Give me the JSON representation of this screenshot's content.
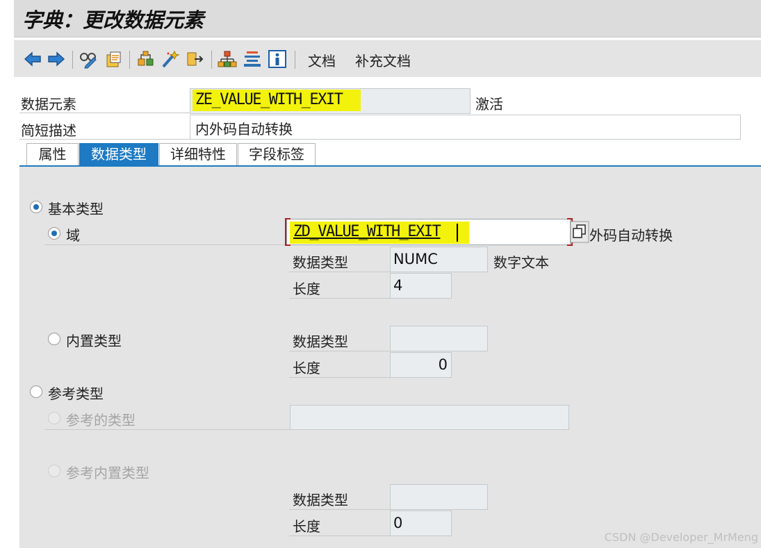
{
  "window": {
    "title": "字典：更改数据元素"
  },
  "toolbar": {
    "icons": [
      "back-icon",
      "forward-icon",
      "display-change-icon",
      "other-object-icon",
      "where-used-icon",
      "activate-icon",
      "check-icon",
      "hierarchy-icon",
      "navigation-stack-icon",
      "info-icon"
    ],
    "documentation": "文档",
    "supplementary_documentation": "补充文档"
  },
  "header": {
    "data_element_label": "数据元素",
    "data_element_value": "ZE_VALUE_WITH_EXIT",
    "status": "激活",
    "short_desc_label": "简短描述",
    "short_desc_value": "内外码自动转换"
  },
  "tabs": [
    {
      "label": "属性",
      "active": false
    },
    {
      "label": "数据类型",
      "active": true
    },
    {
      "label": "详细特性",
      "active": false
    },
    {
      "label": "字段标签",
      "active": false
    }
  ],
  "content": {
    "elementary_type": {
      "label": "基本类型",
      "selected": true
    },
    "domain": {
      "label": "域",
      "selected": true,
      "value": "ZD_VALUE_WITH_EXIT",
      "description": "外码自动转换",
      "data_type_label": "数据类型",
      "data_type_value": "NUMC",
      "data_type_desc": "数字文本",
      "length_label": "长度",
      "length_value": "4"
    },
    "builtin_type": {
      "label": "内置类型",
      "selected": false,
      "data_type_label": "数据类型",
      "data_type_value": "",
      "length_label": "长度",
      "length_value": "0"
    },
    "reference_type": {
      "label": "参考类型",
      "selected": false
    },
    "name_of_ref_type": {
      "label": "参考的类型",
      "value": ""
    },
    "ref_builtin_type": {
      "label": "参考内置类型",
      "data_type_label": "数据类型",
      "data_type_value": "",
      "length_label": "长度",
      "length_value": "0"
    }
  },
  "colors": {
    "accent": "#1d7ac3",
    "highlight": "#f2f20c",
    "panel": "#e4e4e4"
  },
  "watermark": "CSDN @Developer_MrMeng"
}
